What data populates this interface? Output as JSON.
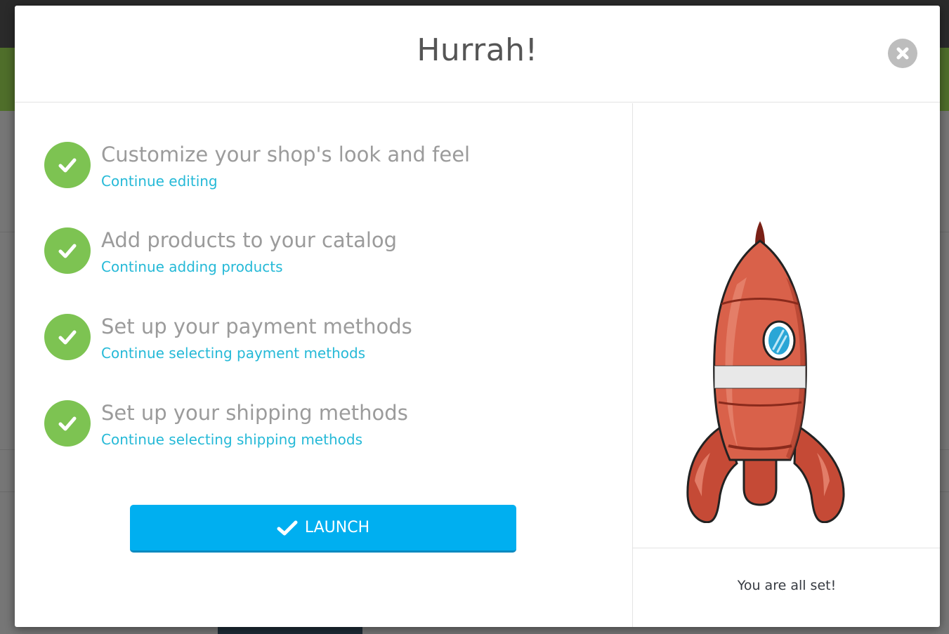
{
  "modal": {
    "title": "Hurrah!",
    "close_icon": "close-circle-icon"
  },
  "steps": [
    {
      "title": "Customize your shop's look and feel",
      "link": "Continue editing",
      "done": true
    },
    {
      "title": "Add products to your catalog",
      "link": "Continue adding products",
      "done": true
    },
    {
      "title": "Set up your payment methods",
      "link": "Continue selecting payment methods",
      "done": true
    },
    {
      "title": "Set up your shipping methods",
      "link": "Continue selecting shipping methods",
      "done": true
    }
  ],
  "launch": {
    "label": "LAUNCH",
    "icon": "checkmark-icon"
  },
  "side": {
    "illustration": "rocket-illustration",
    "message": "You are all set!"
  },
  "colors": {
    "check_green": "#7dc352",
    "link_blue": "#25b9d7",
    "launch_blue": "#00aff0",
    "rocket_red": "#d9614a"
  }
}
